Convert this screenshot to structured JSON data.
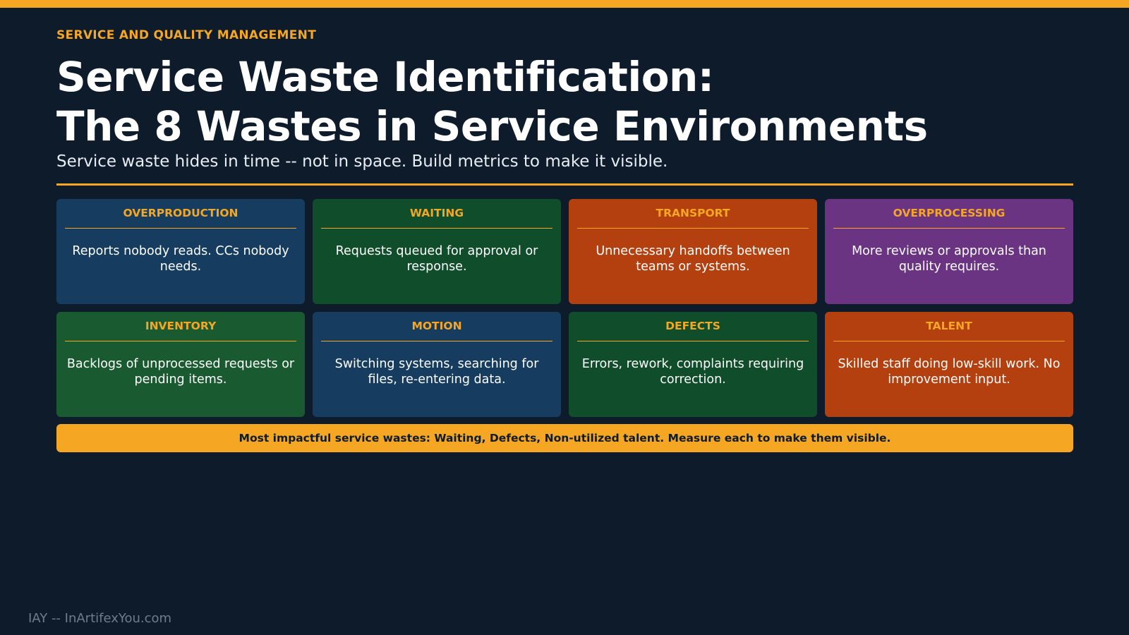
{
  "header": {
    "eyebrow": "SERVICE AND QUALITY MANAGEMENT",
    "title_line1": "Service Waste Identification:",
    "title_line2": "The 8 Wastes in Service Environments",
    "subtitle": "Service waste hides in time -- not in space. Build metrics to make it visible."
  },
  "wastes": [
    {
      "title": "OVERPRODUCTION",
      "text": "Reports nobody reads. CCs nobody needs.",
      "color": "#163d5f"
    },
    {
      "title": "WAITING",
      "text": "Requests queued for approval or response.",
      "color": "#0f4d2b"
    },
    {
      "title": "TRANSPORT",
      "text": "Unnecessary handoffs between teams or systems.",
      "color": "#b5400f"
    },
    {
      "title": "OVERPROCESSING",
      "text": "More reviews or approvals than quality requires.",
      "color": "#6a3483"
    },
    {
      "title": "INVENTORY",
      "text": "Backlogs of unprocessed requests or pending items.",
      "color": "#195a30"
    },
    {
      "title": "MOTION",
      "text": "Switching systems, searching for files, re-entering data.",
      "color": "#163d5f"
    },
    {
      "title": "DEFECTS",
      "text": "Errors, rework, complaints requiring correction.",
      "color": "#0f4d2b"
    },
    {
      "title": "TALENT",
      "text": "Skilled staff doing low-skill work. No improvement input.",
      "color": "#b5400f"
    }
  ],
  "callout": "Most impactful service wastes: Waiting, Defects, Non-utilized talent. Measure each to make them visible.",
  "footer": "IAY -- InArtifexYou.com",
  "colors": {
    "background": "#0d1b2a",
    "accent": "#f5a623"
  }
}
